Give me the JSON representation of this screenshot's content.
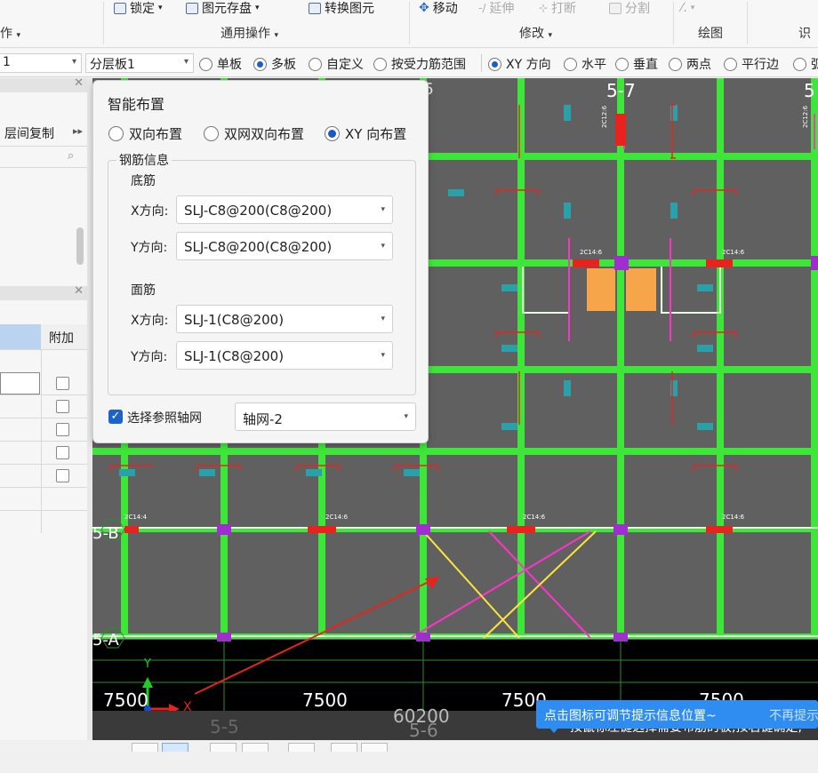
{
  "ribbon": {
    "row1": {
      "lock": "锁定",
      "save_element": "图元存盘",
      "convert_element": "转换图元",
      "move": "移动",
      "extend": "延伸",
      "break": "打断",
      "split": "分割"
    },
    "groups": {
      "left_cut": "作",
      "common_ops": "通用操作",
      "modify": "修改",
      "draw": "绘图",
      "recognize_cut": "识"
    }
  },
  "optbar": {
    "floor_value": "1",
    "layer_value": "分层板1",
    "options": [
      "单板",
      "多板",
      "自定义",
      "按受力筋范围",
      "XY 方向",
      "水平",
      "垂直",
      "两点",
      "平行边",
      "弧"
    ],
    "selected": [
      "多板",
      "XY 方向"
    ]
  },
  "left_panel": {
    "floor_copy": "层间复制",
    "table_header": "附加",
    "checkboxes": [
      false,
      false,
      false,
      false,
      false
    ]
  },
  "dialog": {
    "title": "智能布置",
    "layout_options": [
      "双向布置",
      "双网双向布置",
      "XY 向布置"
    ],
    "selected_layout": "XY 向布置",
    "steel_info": "钢筋信息",
    "bottom": {
      "label": "底筋",
      "x_label": "X方向:",
      "x_value": "SLJ-C8@200(C8@200)",
      "y_label": "Y方向:",
      "y_value": "SLJ-C8@200(C8@200)"
    },
    "top": {
      "label": "面筋",
      "x_label": "X方向:",
      "x_value": "SLJ-1(C8@200)",
      "y_label": "Y方向:",
      "y_value": "SLJ-1(C8@200)"
    },
    "ref_grid_label": "选择参照轴网",
    "ref_grid_checked": true,
    "ref_grid_value": "轴网-2"
  },
  "canvas": {
    "axis_top": [
      "6",
      "5-7",
      "5"
    ],
    "axis_left": [
      "5-B",
      "5-A"
    ],
    "axis_bottom": [
      "5-5",
      "5-6"
    ],
    "spans": [
      "7500",
      "7500",
      "7500",
      "7500"
    ],
    "total": "60200",
    "rebar_labels": [
      "2C14:6",
      "2C12:6",
      "2C14:4"
    ],
    "ucs_x": "X",
    "ucs_y": "Y"
  },
  "hint": {
    "text": "点击图标可调节提示信息位置~",
    "dismiss": "不再提示"
  },
  "status": {
    "text": "按鼠标左键选择需要布筋的板,按右键确定,"
  }
}
